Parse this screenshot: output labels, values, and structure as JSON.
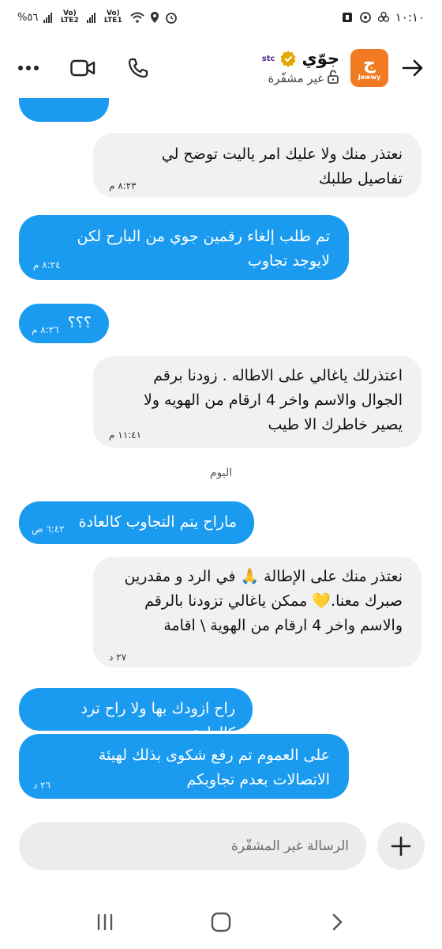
{
  "status_bar": {
    "time": "١٠:١٠",
    "battery": "%٥٦",
    "sim1": "Vo) LTE1",
    "sim2": "Vo) LTE2"
  },
  "header": {
    "contact_name": "جوّي",
    "carrier": "stc",
    "subtitle": "غير مشفّرة",
    "avatar_brand": "Jawwy",
    "accent": "#f07b22"
  },
  "messages": [
    {
      "dir": "out",
      "text": "",
      "time": ""
    },
    {
      "dir": "in",
      "text": "نعتذر منك ولا عليك امر ياليت توضح لي تفاصيل طلبك",
      "time": "٨:٢٣ م"
    },
    {
      "dir": "out",
      "text": "تم طلب إلغاء رقمين جوي من البارح لكن لايوجد تجاوب",
      "time": "٨:٢٤ م"
    },
    {
      "dir": "out",
      "text": "؟؟؟",
      "time": "٨:٢٦ م"
    },
    {
      "dir": "in",
      "text": "اعتذرلك ياغالي على الاطاله . زودنا برقم الجوال والاسم واخر 4 ارقام من الهويه ولا يصير خاطرك الا طيب",
      "time": "١١:٤١ م"
    },
    {
      "dir": "out",
      "text": "ماراح يتم التجاوب كالعادة",
      "time": "٦:٤٢ ص"
    },
    {
      "dir": "in",
      "text": "نعتذر منك على الإطالة 🙏 في الرد و مقدرين صبرك معنا.💛 ممكن ياغالي تزودنا بالرقم والاسم واخر 4 ارقام من الهوية \\ اقامة",
      "time": "٢٧ د"
    },
    {
      "dir": "out",
      "text": "راح ازودك بها ولا راح ترد كالعادة",
      "time": ""
    },
    {
      "dir": "out",
      "text": "على العموم تم رفع شكوى بذلك لهيئة الاتصالات بعدم تجاوبكم",
      "time": "٢٦ د"
    }
  ],
  "day_separator": "اليوم",
  "composer": {
    "placeholder": "الرسالة غير المشفّرة"
  },
  "colors": {
    "outgoing_bubble": "#1a9bf0",
    "incoming_bubble": "#f1f1f3"
  }
}
